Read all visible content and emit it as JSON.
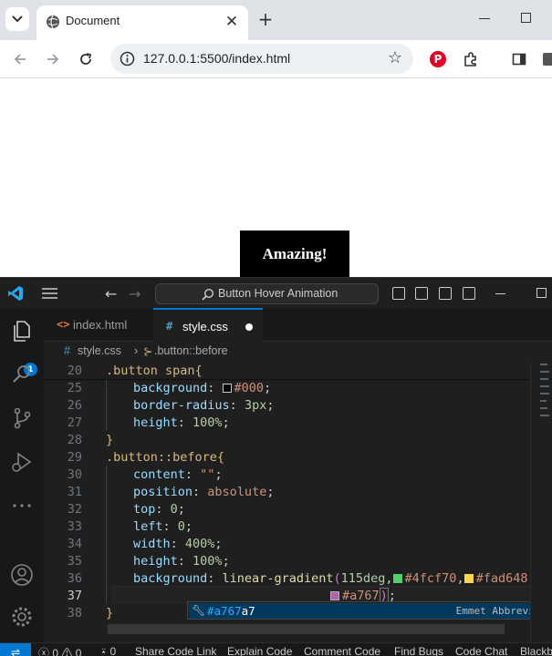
{
  "browser": {
    "tab_title": "Document",
    "tab_close": "✕",
    "new_tab": "+",
    "url": "127.0.0.1:5500/index.html",
    "star": "☆"
  },
  "page": {
    "button_label": "Amazing!"
  },
  "vscode": {
    "search_label": "Button Hover Animation",
    "explorer_badge": "1",
    "tabs": [
      {
        "label": "index.html",
        "icon": "<>"
      },
      {
        "label": "style.css",
        "icon": "#"
      }
    ],
    "breadcrumb": {
      "file": "style.css",
      "symbol": ".button::before"
    },
    "lines": {
      "n20": "20",
      "n25": "25",
      "n26": "26",
      "n27": "27",
      "n28": "28",
      "n29": "29",
      "n30": "30",
      "n31": "31",
      "n32": "32",
      "n33": "33",
      "n34": "34",
      "n35": "35",
      "n36": "36",
      "n37": "37",
      "n38": "38"
    },
    "code": {
      "l20": ".button span{",
      "l25_prop": "background",
      "l25_val": "#000",
      "l26_prop": "border-radius",
      "l26_val": "3px",
      "l27_prop": "height",
      "l27_val": "100%",
      "l28": "}",
      "l29": ".button::before{",
      "l30_prop": "content",
      "l30_val": "\"\"",
      "l31_prop": "position",
      "l31_val": "absolute",
      "l32_prop": "top",
      "l32_val": "0",
      "l33_prop": "left",
      "l33_val": "0",
      "l34_prop": "width",
      "l34_val": "400%",
      "l35_prop": "height",
      "l35_val": "100%",
      "l36_prop": "background",
      "l36_fn": "linear-gradient",
      "l36_deg": "115deg",
      "l36_c1": "#4fcf70",
      "l36_c2": "#fad648",
      "l37_c3": "#a767",
      "l38": "}"
    },
    "suggestion": {
      "match": "#a767",
      "rest": "a7",
      "detail": "Emmet Abbreviat"
    },
    "status": {
      "errors": "0",
      "warnings": "0",
      "ports": "0",
      "items": [
        "Share Code Link",
        "Explain Code",
        "Comment Code",
        "Find Bugs",
        "Code Chat",
        "Blackb"
      ]
    },
    "colors": {
      "accent": "#0078d4",
      "swatch1": "#4fcf70",
      "swatch2": "#fad648",
      "swatch3": "#a767a7"
    }
  }
}
